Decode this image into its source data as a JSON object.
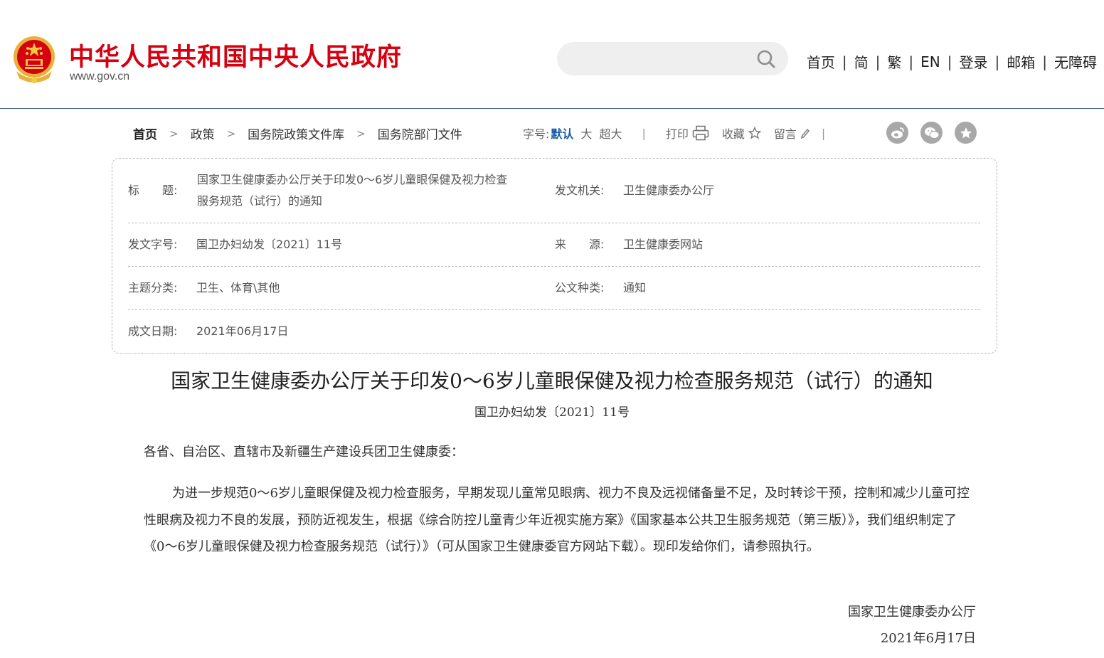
{
  "header": {
    "site_title": "中华人民共和国中央人民政府",
    "site_url": "www.gov.cn",
    "search": {
      "placeholder": ""
    },
    "nav": [
      "首页",
      "简",
      "繁",
      "EN",
      "登录",
      "邮箱",
      "无障碍"
    ],
    "nav_separator": "|"
  },
  "breadcrumb": {
    "items": [
      "首页",
      "政策",
      "国务院政策文件库",
      "国务院部门文件"
    ],
    "separator": ">"
  },
  "toolbar": {
    "font_size_label": "字号:",
    "font_default": "默认",
    "font_large": "大",
    "font_xlarge": "超大",
    "divider": "|",
    "print": "打印",
    "favorite": "收藏",
    "message": "留言",
    "share_icons": [
      "weibo-icon",
      "wechat-icon",
      "star-icon"
    ]
  },
  "info": {
    "title_label": "标　　题:",
    "title_value_line1": "国家卫生健康委办公厅关于印发0～6岁儿童眼保健及视力检查",
    "title_value_line2": "服务规范（试行）的通知",
    "issuer_label": "发文机关:",
    "issuer_value": "卫生健康委办公厅",
    "docno_label": "发文字号:",
    "docno_value": "国卫办妇幼发〔2021〕11号",
    "source_label": "来　　源:",
    "source_value": "卫生健康委网站",
    "topic_label": "主题分类:",
    "topic_value": "卫生、体育\\其他",
    "type_label": "公文种类:",
    "type_value": "通知",
    "date_label": "成文日期:",
    "date_value": "2021年06月17日"
  },
  "article": {
    "title": "国家卫生健康委办公厅关于印发0～6岁儿童眼保健及视力检查服务规范（试行）的通知",
    "doc_number": "国卫办妇幼发〔2021〕11号",
    "salutation": "各省、自治区、直辖市及新疆生产建设兵团卫生健康委：",
    "paragraph": "为进一步规范0～6岁儿童眼保健及视力检查服务，早期发现儿童常见眼病、视力不良及远视储备量不足，及时转诊干预，控制和减少儿童可控性眼病及视力不良的发展，预防近视发生，根据《综合防控儿童青少年近视实施方案》《国家基本公共卫生服务规范（第三版）》，我们组织制定了《0～6岁儿童眼保健及视力检查服务规范（试行）》（可从国家卫生健康委官方网站下载）。现印发给你们，请参照执行。",
    "signature": "国家卫生健康委办公厅",
    "sign_date": "2021年6月17日"
  },
  "colors": {
    "brand_red": "#d7000f",
    "accent_blue": "#1a5aa8",
    "header_rule": "#4b6a8c"
  }
}
